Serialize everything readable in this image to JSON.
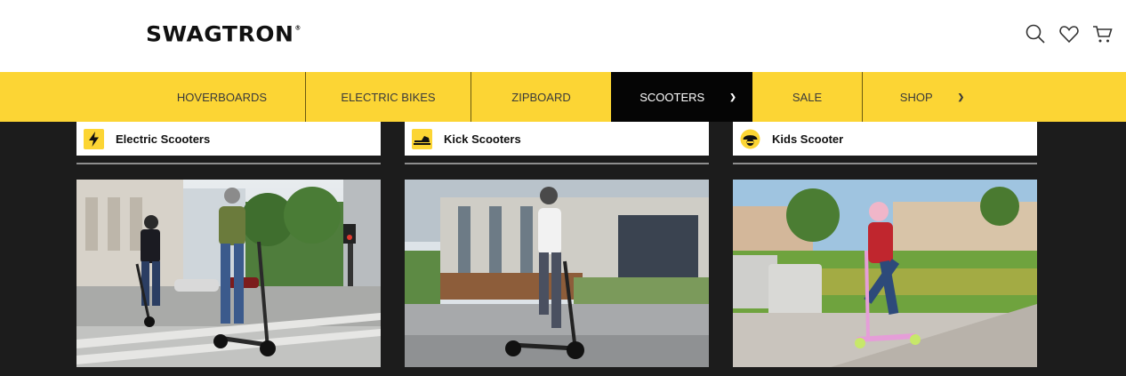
{
  "header": {
    "logo_text": "SWAGTRON",
    "logo_mark": "®",
    "icons": [
      "search-icon",
      "heart-icon",
      "cart-icon"
    ]
  },
  "nav": {
    "items": [
      {
        "label": "HOVERBOARDS"
      },
      {
        "label": "ELECTRIC BIKES"
      },
      {
        "label": "ZIPBOARD"
      },
      {
        "label": "SCOOTERS",
        "active": true,
        "dropdown": true
      },
      {
        "label": "SALE"
      },
      {
        "label": "SHOP",
        "dropdown": true
      }
    ],
    "background": "#fcd534",
    "active_background": "#050505"
  },
  "categories": [
    {
      "label": "Electric Scooters",
      "icon": "lightning-icon"
    },
    {
      "label": "Kick Scooters",
      "icon": "kick-scooter-icon"
    },
    {
      "label": "Kids Scooter",
      "icon": "kid-helmet-icon"
    }
  ],
  "colors": {
    "brand_yellow": "#fcd534",
    "panel_dark": "#1c1c1c"
  }
}
